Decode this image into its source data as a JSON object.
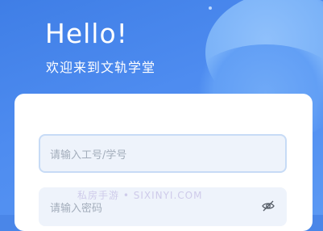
{
  "header": {
    "title": "Hello!",
    "subtitle": "欢迎来到文轨学堂"
  },
  "login_form": {
    "account_placeholder": "请输入工号/学号",
    "password_placeholder": "请输入密码",
    "password_toggle_icon": "eye-off-icon"
  },
  "watermark": {
    "text": "私房手游 • SIXINYI.COM"
  },
  "colors": {
    "brand_blue": "#4a86e8",
    "field_bg": "#eef3fb",
    "field_focus_border": "#c7dbf6",
    "placeholder": "#a3adbb"
  }
}
